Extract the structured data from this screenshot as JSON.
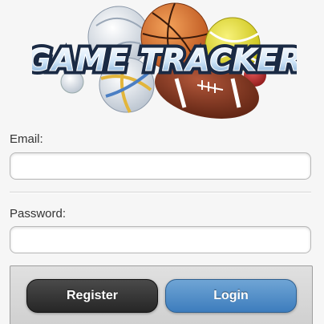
{
  "app": {
    "logo_text": "GAME TRACKER"
  },
  "form": {
    "email": {
      "label": "Email:",
      "value": "",
      "placeholder": ""
    },
    "password": {
      "label": "Password:",
      "value": "",
      "placeholder": ""
    }
  },
  "actions": {
    "register_label": "Register",
    "login_label": "Login"
  },
  "icons": {
    "logo": "sports-balls-logo-icon"
  },
  "colors": {
    "register_button": "#2f2f2f",
    "login_button": "#4a89c8",
    "background": "#f6f6f6"
  }
}
